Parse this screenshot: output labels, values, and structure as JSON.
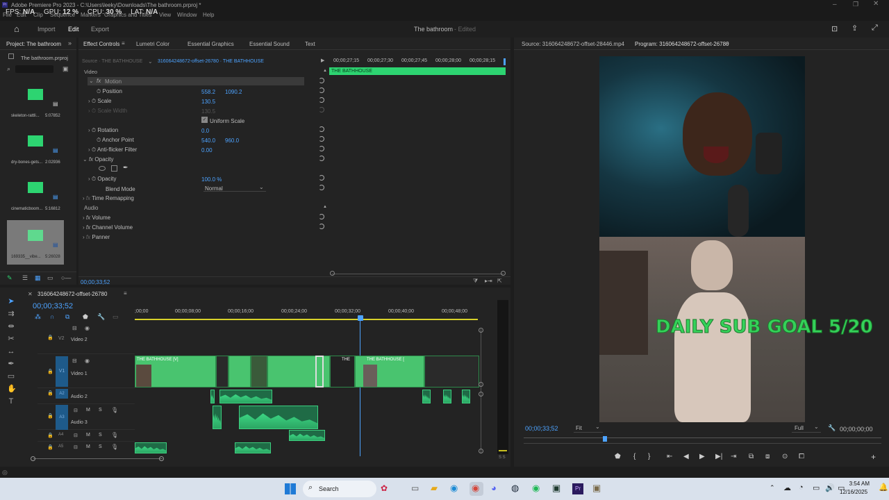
{
  "app": {
    "title": "Adobe Premiere Pro 2023 - C:\\Users\\leeky\\Downloads\\The bathroom.prproj *",
    "overlay": {
      "fps_label": "FPS:",
      "fps": "N/A",
      "gpu_label": "GPU:",
      "gpu": "12 %",
      "cpu_label": "CPU:",
      "cpu": "30 %",
      "lat_label": "LAT:",
      "lat": "N/A"
    },
    "menu": [
      "File",
      "Edit",
      "Clip",
      "Sequence",
      "Markers",
      "Graphics and Titles",
      "View",
      "Window",
      "Help"
    ],
    "workspace": {
      "tabs": [
        "Import",
        "Edit",
        "Export"
      ],
      "active": "Edit",
      "project_name": "The bathroom",
      "status": "Edited"
    }
  },
  "project": {
    "tab": "Project: The bathroom",
    "file": "The bathroom.prproj",
    "items": [
      {
        "name": "skeleton-rattli...",
        "duration": "5:07852"
      },
      {
        "name": "dry-bones-gets...",
        "duration": "2:02936"
      },
      {
        "name": "cinematicboom...",
        "duration": "5:16812"
      },
      {
        "name": "169335__vibe...",
        "duration": "5:26028"
      }
    ]
  },
  "effects": {
    "tab": "Effect Controls",
    "tabs2": [
      "Lumetri Color",
      "Essential Graphics",
      "Essential Sound",
      "Text"
    ],
    "source": "Source · THE BATHHOUSE",
    "sequence": "316064248672-offset-26780 · THE BATHHOUSE",
    "video_label": "Video",
    "motion": "Motion",
    "position_label": "Position",
    "position_x": "558.2",
    "position_y": "1090.2",
    "scale_label": "Scale",
    "scale": "130.5",
    "scale_width_label": "Scale Width",
    "scale_width": "130.5",
    "uniform_label": "Uniform Scale",
    "rotation_label": "Rotation",
    "rotation": "0.0",
    "anchor_label": "Anchor Point",
    "anchor_x": "540.0",
    "anchor_y": "960.0",
    "flicker_label": "Anti-flicker Filter",
    "flicker": "0.00",
    "opacity_section": "Opacity",
    "opacity_label": "Opacity",
    "opacity": "100.0 %",
    "blend_label": "Blend Mode",
    "blend": "Normal",
    "time_remap": "Time Remapping",
    "audio_label": "Audio",
    "volume": "Volume",
    "channel_volume": "Channel Volume",
    "panner": "Panner",
    "timecode": "00;00;33;52",
    "mini_ruler": [
      "00;00;27;15",
      "00;00;27;30",
      "00;00;27;45",
      "00;00;28;00",
      "00;00;28;15"
    ],
    "clip_label": "THE BATHHOUSE"
  },
  "source_monitor": {
    "tab": "Source: 316064248672-offset-28446.mp4"
  },
  "program": {
    "tab": "Program: 316064248672-offset-26780",
    "overlay_text": "DAILY SUB GOAL 5/20",
    "timecode": "00;00;33;52",
    "fit": "Fit",
    "quality": "Full",
    "duration": "00;00;00;00"
  },
  "timeline": {
    "sequence": "316064248672-offset-26780",
    "timecode": "00;00;33;52",
    "ruler": [
      ";00;00",
      "00;00;08;00",
      "00;00;16;00",
      "00;00;24;00",
      "00;00;32;00",
      "00;00;40;00",
      "00;00;48;00"
    ],
    "tracks": [
      {
        "id": "V2",
        "name": "Video 2"
      },
      {
        "id": "V1",
        "name": "Video 1"
      },
      {
        "id": "A2",
        "name": "Audio 2"
      },
      {
        "id": "A3",
        "name": "Audio 3"
      },
      {
        "id": "A4",
        "name": ""
      },
      {
        "id": "A5",
        "name": ""
      }
    ],
    "clips": [
      "THE BATHHOUSE [V]",
      "THE",
      "THE BATHHOUSE ["
    ],
    "meter_label": "S S"
  },
  "taskbar": {
    "search": "Search",
    "time": "3:54 AM",
    "date": "12/16/2025"
  },
  "colors": {
    "accent": "#4da3ff",
    "clip_green": "#49c46f",
    "overlay_text": "#35d15a"
  }
}
